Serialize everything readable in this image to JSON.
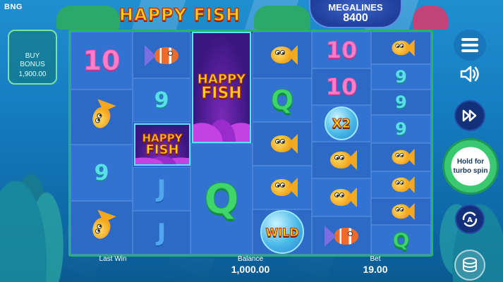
{
  "brand": "BNG",
  "logo": {
    "word1": "HAPPY",
    "word2": "FISH"
  },
  "megalines": {
    "title": "MEGALINES",
    "value": "8400"
  },
  "buy_bonus": {
    "label_line1": "BUY",
    "label_line2": "BONUS",
    "price": "1,900.00"
  },
  "reels": {
    "col1": [
      "10",
      "goldfish",
      "9",
      "goldfish"
    ],
    "col2": [
      "clownfish",
      "9",
      "HAPPY FISH",
      "J",
      "J"
    ],
    "col3": [
      "HAPPY FISH",
      "Q"
    ],
    "col4": [
      "goldfish",
      "Q",
      "goldfish",
      "goldfish",
      "WILD"
    ],
    "col5": [
      "10",
      "10",
      "X2",
      "goldfish",
      "goldfish",
      "clownfish"
    ],
    "col6": [
      "goldfish",
      "9",
      "9",
      "9",
      "goldfish",
      "goldfish",
      "goldfish",
      "Q"
    ]
  },
  "symbols": {
    "happy_fish_line1": "HAPPY",
    "happy_fish_line2": "FISH",
    "wild": "WILD",
    "multiplier": "X2",
    "ten": "10",
    "nine": "9",
    "jack": "J",
    "queen": "Q"
  },
  "bottom": {
    "last_win_label": "Last Win",
    "balance_label": "Balance",
    "balance_value": "1,000.00",
    "bet_label": "Bet",
    "bet_value": "19.00"
  },
  "controls": {
    "spin_text_line1": "Hold for",
    "spin_text_line2": "turbo spin",
    "menu_icon": "menu-icon",
    "sound_icon": "speaker-icon",
    "forward_icon": "fast-forward-icon",
    "autoplay_icon": "autoplay-icon",
    "coins_icon": "coins-icon"
  },
  "colors": {
    "frame": "#2bb26a",
    "gold_text": "#ffd11a",
    "spin_green": "#3ac970"
  }
}
